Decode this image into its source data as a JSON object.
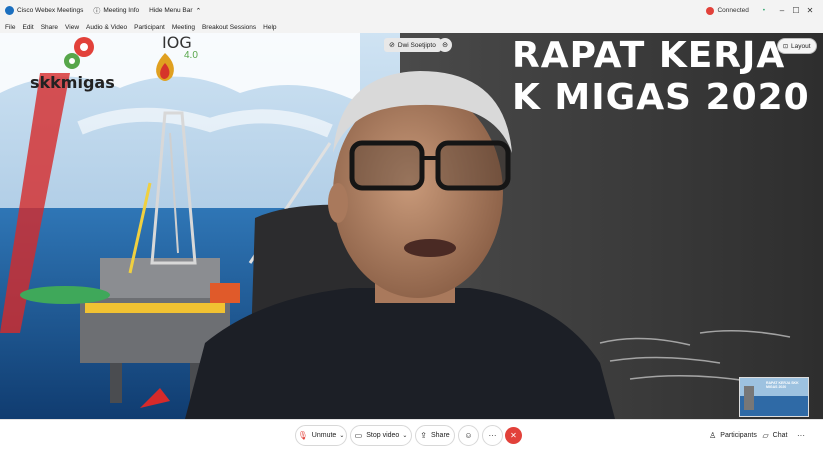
{
  "titlebar": {
    "app_title": "Cisco Webex Meetings",
    "meeting_info": "Meeting Info",
    "hide_menu_bar": "Hide Menu Bar",
    "connection_status": "Connected"
  },
  "menu": [
    "File",
    "Edit",
    "Share",
    "View",
    "Audio & Video",
    "Participant",
    "Meeting",
    "Breakout Sessions",
    "Help"
  ],
  "video": {
    "presenter_name": "Dwi Soetjipto",
    "layout_label": "Layout",
    "headline_line1": "RAPAT KERJA",
    "headline_line2": "K MIGAS 2020",
    "logo_left": "skkmigas",
    "logo_right": "IOG",
    "logo_right_version": "4.0",
    "thumbnail_text": "RAPAT KERJA SKK MIGAS 2020"
  },
  "controls": {
    "unmute": "Unmute",
    "stop_video": "Stop video",
    "share": "Share",
    "participants": "Participants",
    "chat": "Chat"
  },
  "colors": {
    "end_call": "#e2413a",
    "ocean": "#1e5d9b",
    "panel_gray": "#3b3b3b"
  }
}
